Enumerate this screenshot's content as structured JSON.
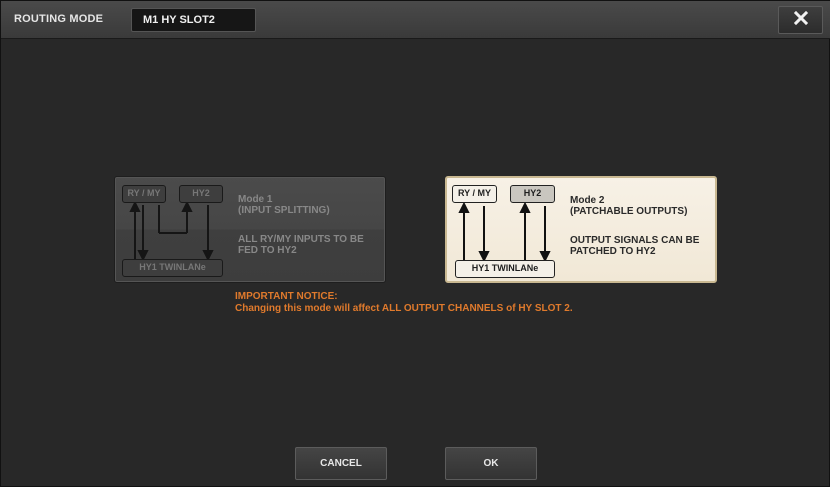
{
  "window": {
    "title": "ROUTING MODE",
    "slot": "M1 HY SLOT2"
  },
  "mode1": {
    "box_left": "RY / MY",
    "box_right": "HY2",
    "box_bottom": "HY1 TWINLANe",
    "title": "Mode 1",
    "subtitle": "(INPUT SPLITTING)",
    "desc_line1": "ALL RY/MY INPUTS TO BE",
    "desc_line2": "FED TO HY2"
  },
  "mode2": {
    "box_left": "RY / MY",
    "box_right": "HY2",
    "box_bottom": "HY1 TWINLANe",
    "title": "Mode 2",
    "subtitle": "(PATCHABLE OUTPUTS)",
    "desc_line1": "OUTPUT SIGNALS CAN BE",
    "desc_line2": "PATCHED TO HY2"
  },
  "notice": {
    "heading": "IMPORTANT NOTICE:",
    "text": "Changing this mode will affect ALL OUTPUT CHANNELS of HY SLOT 2."
  },
  "buttons": {
    "cancel": "CANCEL",
    "ok": "OK"
  },
  "icons": {
    "close": "close-icon"
  },
  "colors": {
    "notice": "#e07a2c",
    "selected_card": "#f1e8d6"
  }
}
